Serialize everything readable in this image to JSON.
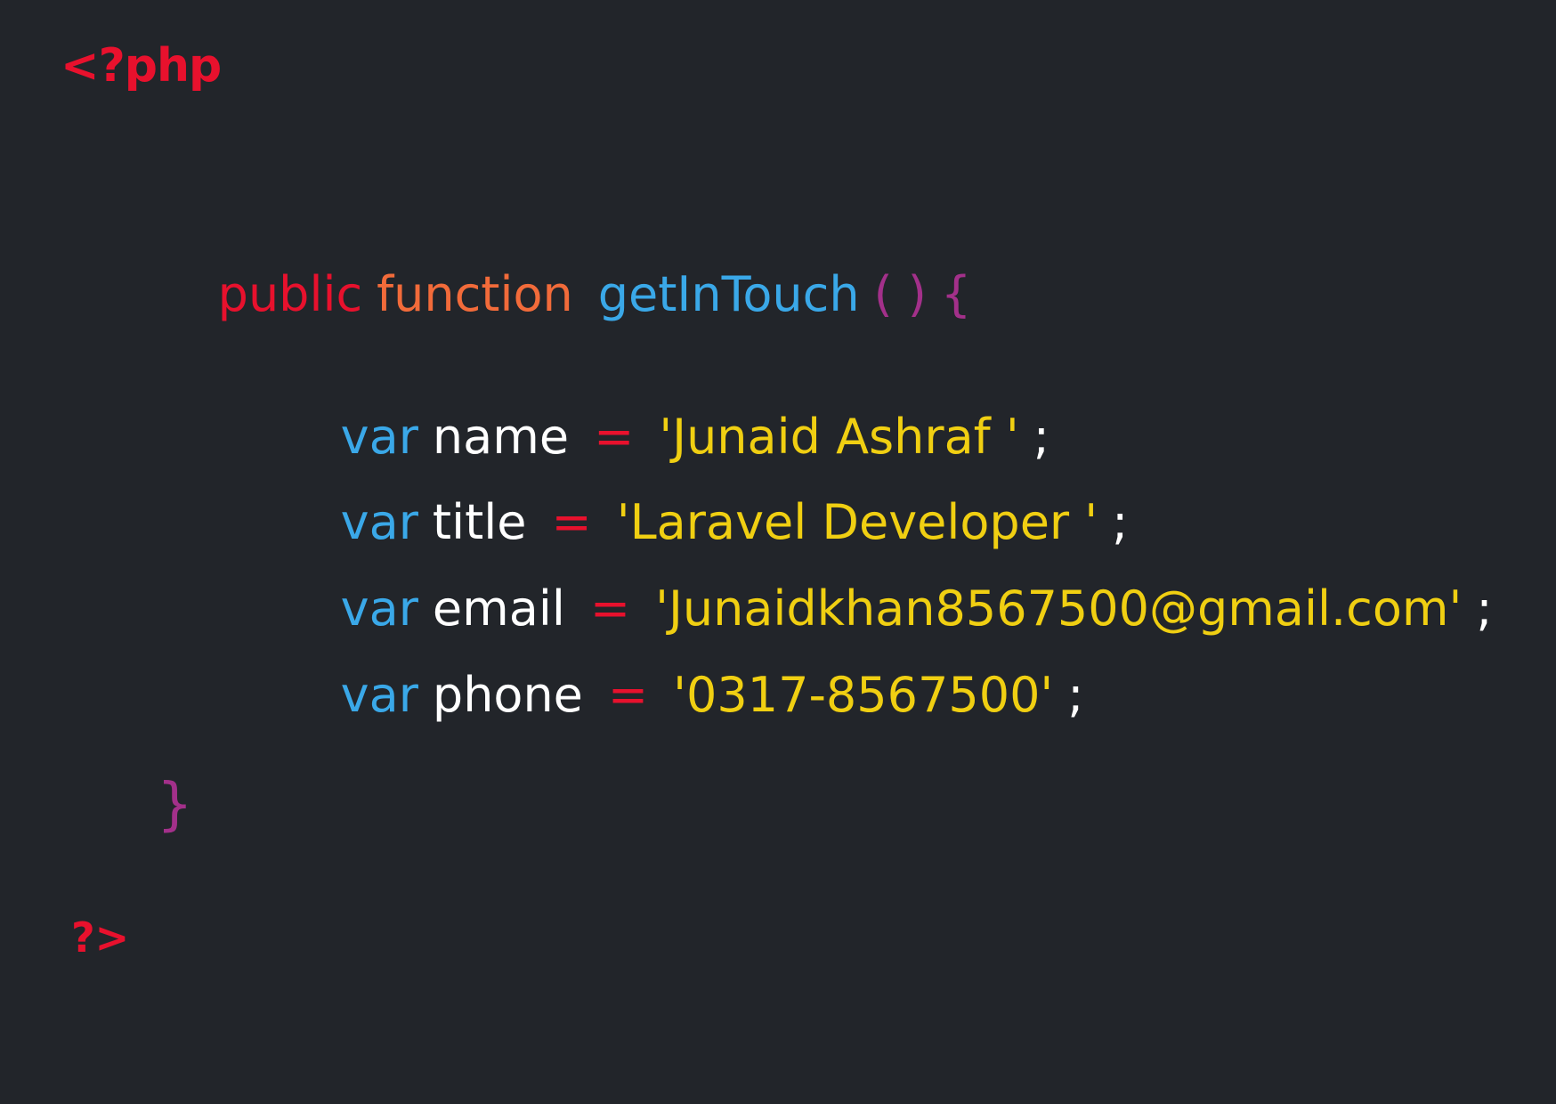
{
  "php_open_tag": "<?php",
  "php_close_tag": "?>",
  "function": {
    "modifier": "public",
    "keyword": "function",
    "name": "getInTouch",
    "params": "( )",
    "open_brace": "{",
    "close_brace": "}"
  },
  "variables": [
    {
      "keyword": "var",
      "name": "name",
      "operator": "=",
      "value": "'Junaid Ashraf '",
      "terminator": ";"
    },
    {
      "keyword": "var",
      "name": "title",
      "operator": "=",
      "value": "'Laravel Developer '",
      "terminator": ";"
    },
    {
      "keyword": "var",
      "name": "email",
      "operator": "=",
      "value": "'Junaidkhan8567500@gmail.com'",
      "terminator": ";"
    },
    {
      "keyword": "var",
      "name": "phone",
      "operator": "=",
      "value": "'0317-8567500'",
      "terminator": ";"
    }
  ],
  "colors": {
    "background": "#22252a",
    "php_tag": "#e8112d",
    "modifier": "#e8112d",
    "keyword_function": "#f26b3a",
    "function_name": "#3aa8e8",
    "punctuation": "#a3308a",
    "var_keyword": "#3aa8e8",
    "identifier": "#ffffff",
    "operator": "#e8112d",
    "string": "#f0cf12",
    "terminator": "#ffffff"
  }
}
